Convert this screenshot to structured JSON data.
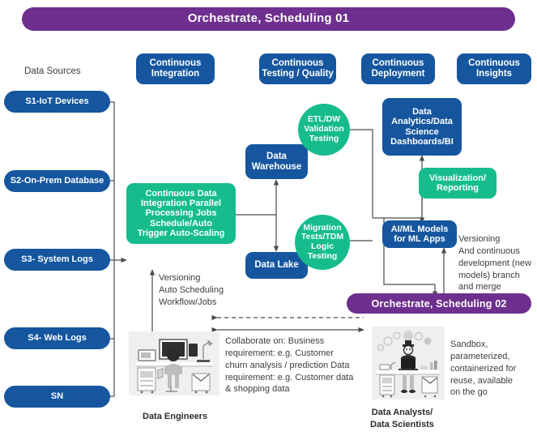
{
  "banners": {
    "top": "Orchestrate, Scheduling 01",
    "bottom": "Orchestrate, Scheduling 02"
  },
  "stage_headers": [
    {
      "label": "Continuous\nIntegration",
      "name": "continuous-integration"
    },
    {
      "label": "Continuous\nTesting / Quality",
      "name": "continuous-testing-quality"
    },
    {
      "label": "Continuous\nDeployment",
      "name": "continuous-deployment"
    },
    {
      "label": "Continuous\nInsights",
      "name": "continuous-insights"
    }
  ],
  "headers": {
    "ci": "Continuous\nIntegration",
    "ctq": "Continuous\nTesting / Quality",
    "cd": "Continuous\nDeployment",
    "cins": "Continuous\nInsights"
  },
  "data_sources": {
    "title": "Data Sources",
    "items": [
      {
        "label": "S1-IoT Devices",
        "name": "source-s1-iot-devices"
      },
      {
        "label": "S2-On-Prem Database",
        "name": "source-s2-on-prem-database"
      },
      {
        "label": "S3- System Logs",
        "name": "source-s3-system-logs"
      },
      {
        "label": "S4- Web Logs",
        "name": "source-s4-web-logs"
      },
      {
        "label": "SN",
        "name": "source-sn"
      }
    ],
    "s1": "S1-IoT Devices",
    "s2": "S2-On-Prem Database",
    "s3": "S3- System Logs",
    "s4": "S4- Web Logs",
    "sn": "SN"
  },
  "nodes": {
    "integration_engine": "Continuous Data\nIntegration Parallel\nProcessing Jobs\nSchedule/Auto\nTrigger Auto-Scaling",
    "data_warehouse": "Data\nWarehouse",
    "data_lake": "Data Lake",
    "etl_validation": "ETL/DW\nValidation\nTesting",
    "migration_tests": "Migration\nTests/TDM\nLogic\nTesting",
    "analytics": "Data\nAnalytics/Data\nScience\nDashboards/BI",
    "visualization": "Visualization/\nReporting",
    "aiml": "AI/ML Models\nfor ML Apps"
  },
  "annotations": {
    "versioning_left": "Versioning\nAuto Scheduling\nWorkflow/Jobs",
    "versioning_right": "Versioning\nAnd continuous\ndevelopment (new\nmodels) branch\nand merge",
    "collaborate": "Collaborate on: Business\nrequirement: e.g. Customer\nchurn analysis / prediction Data\nrequirement: e.g. Customer data\n& shopping data",
    "sandbox": "Sandbox,\nparameterized,\ncontainerized for\nreuse, available\non the go"
  },
  "personas": {
    "engineers": "Data Engineers",
    "analysts": "Data Analysts/\nData Scientists"
  },
  "colors": {
    "blue": "#15569F",
    "teal": "#17BC8D",
    "purple": "#6E2F8E",
    "line": "#4a4a4a",
    "text": "#3d3d3d",
    "illustration_bg": "#efefef"
  }
}
